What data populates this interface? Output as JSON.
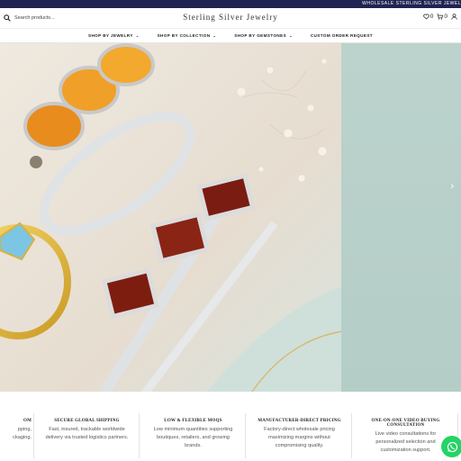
{
  "topbar": {
    "text": "WHOLESALE STERLING SILVER JEWEL"
  },
  "header": {
    "search_placeholder": "Search products...",
    "logo": "Sterling Silver Jewelry",
    "wishlist_count": "0",
    "cart_count": "0"
  },
  "nav": {
    "items": [
      {
        "label": "SHOP BY JEWELRY",
        "chevron": "⌄"
      },
      {
        "label": "SHOP BY COLLECTION",
        "chevron": "⌄"
      },
      {
        "label": "SHOP BY GEMSTONES",
        "chevron": "⌄"
      },
      {
        "label": "CUSTOM ORDER REQUEST",
        "chevron": ""
      }
    ]
  },
  "hero": {
    "next_arrow": "›"
  },
  "features": [
    {
      "title": "OM",
      "description": "pping,\nckaging."
    },
    {
      "title": "SECURE GLOBAL SHIPPING",
      "description": "Fast, insured, trackable worldwide\ndelivery via trusted logistics partners."
    },
    {
      "title": "LOW & FLEXIBLE MOQS",
      "description": "Low minimum quantities supporting\nboutiques, retailers, and growing\nbrands."
    },
    {
      "title": "MANUFACTURER-DIRECT PRICING",
      "description": "Factory-direct wholesale pricing\nmaximizing margins without\ncompromising quality."
    },
    {
      "title": "ONE-ON-ONE VIDEO BUYING\nCONSULTATION",
      "description": "Live video consultations for\npersonalized selection and\ncustomization support."
    }
  ],
  "colors": {
    "topbar": "#1f2452",
    "whatsapp": "#25d366",
    "hero_panel": "#b8cfc9"
  },
  "icons": [
    "search-icon",
    "heart-icon",
    "cart-icon",
    "user-icon",
    "chevron-right-icon",
    "whatsapp-icon"
  ]
}
